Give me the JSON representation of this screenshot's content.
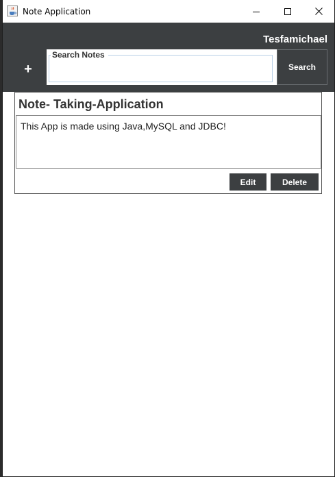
{
  "window": {
    "title": "Note Application",
    "icons": [
      "java-cup-icon",
      "minimize-icon",
      "maximize-icon",
      "close-icon"
    ]
  },
  "header": {
    "username": "Tesfamichael",
    "add_label": "+",
    "search": {
      "legend": "Search Notes",
      "value": "",
      "button_label": "Search"
    }
  },
  "notes": [
    {
      "title": "Note- Taking-Application",
      "body": "This App is made using Java,MySQL and JDBC!",
      "edit_label": "Edit",
      "delete_label": "Delete"
    }
  ],
  "colors": {
    "header_bg": "#3c3f41",
    "button_bg": "#3c3f41",
    "text_light": "#ffffff",
    "title_text": "#333333"
  }
}
